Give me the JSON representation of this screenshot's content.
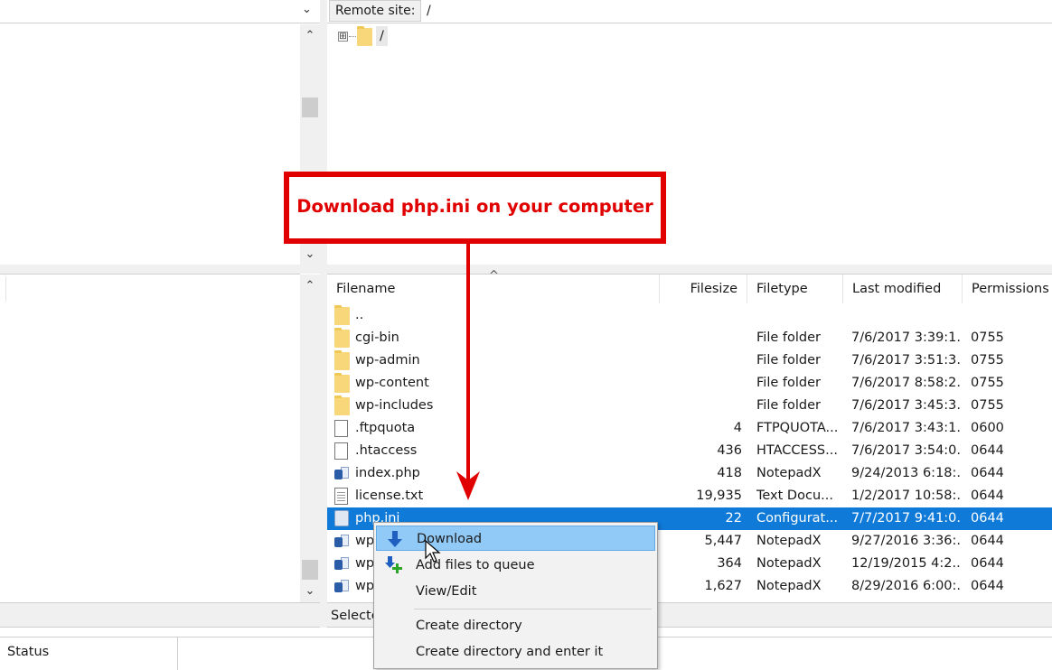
{
  "remote_site": {
    "label": "Remote site:",
    "path": "/"
  },
  "remote_tree": {
    "root_label": "/",
    "expander": "⊞"
  },
  "callout": {
    "text": "Download php.ini on your computer",
    "color": "#e10000"
  },
  "file_list": {
    "columns": [
      "Filename",
      "Filesize",
      "Filetype",
      "Last modified",
      "Permissions"
    ],
    "sort_indicator": "^",
    "rows": [
      {
        "icon": "folder-icon",
        "name": "..",
        "size": "",
        "type": "",
        "modified": "",
        "perms": ""
      },
      {
        "icon": "folder-icon",
        "name": "cgi-bin",
        "size": "",
        "type": "File folder",
        "modified": "7/6/2017 3:39:1...",
        "perms": "0755"
      },
      {
        "icon": "folder-icon",
        "name": "wp-admin",
        "size": "",
        "type": "File folder",
        "modified": "7/6/2017 3:51:3...",
        "perms": "0755"
      },
      {
        "icon": "folder-icon",
        "name": "wp-content",
        "size": "",
        "type": "File folder",
        "modified": "7/6/2017 8:58:2...",
        "perms": "0755"
      },
      {
        "icon": "folder-icon",
        "name": "wp-includes",
        "size": "",
        "type": "File folder",
        "modified": "7/6/2017 3:45:3...",
        "perms": "0755"
      },
      {
        "icon": "blank-file-icon",
        "name": ".ftpquota",
        "size": "4",
        "type": "FTPQUOTA...",
        "modified": "7/6/2017 3:43:1...",
        "perms": "0600"
      },
      {
        "icon": "blank-file-icon",
        "name": ".htaccess",
        "size": "436",
        "type": "HTACCESS...",
        "modified": "7/6/2017 3:54:0...",
        "perms": "0644"
      },
      {
        "icon": "php-file-icon",
        "name": "index.php",
        "size": "418",
        "type": "NotepadX",
        "modified": "9/24/2013 6:18:...",
        "perms": "0644"
      },
      {
        "icon": "text-file-icon",
        "name": "license.txt",
        "size": "19,935",
        "type": "Text Docu...",
        "modified": "1/2/2017 10:58:...",
        "perms": "0644"
      },
      {
        "icon": "config-file-icon",
        "name": "php.ini",
        "size": "22",
        "type": "Configurat...",
        "modified": "7/7/2017 9:41:0...",
        "perms": "0644",
        "selected": true
      },
      {
        "icon": "php-file-icon",
        "name": "wp",
        "size": "5,447",
        "type": "NotepadX",
        "modified": "9/27/2016 3:36:...",
        "perms": "0644"
      },
      {
        "icon": "php-file-icon",
        "name": "wp",
        "size": "364",
        "type": "NotepadX",
        "modified": "12/19/2015 4:2...",
        "perms": "0644"
      },
      {
        "icon": "php-file-icon",
        "name": "wp",
        "size": "1,627",
        "type": "NotepadX",
        "modified": "8/29/2016 6:00:...",
        "perms": "0644"
      }
    ]
  },
  "selection_status": "Selecte",
  "context_menu": {
    "items": [
      {
        "label": "Download",
        "icon": "download-arrow-icon",
        "hover": true
      },
      {
        "label": "Add files to queue",
        "icon": "add-to-queue-icon"
      },
      {
        "label": "View/Edit"
      },
      {
        "separator": true
      },
      {
        "label": "Create directory"
      },
      {
        "label": "Create directory and enter it"
      }
    ]
  },
  "bottom_tabs": {
    "status": "Status"
  },
  "colors": {
    "selection": "#0f7ad8",
    "menu_hover": "#91c9f7",
    "annotation": "#e10000"
  }
}
